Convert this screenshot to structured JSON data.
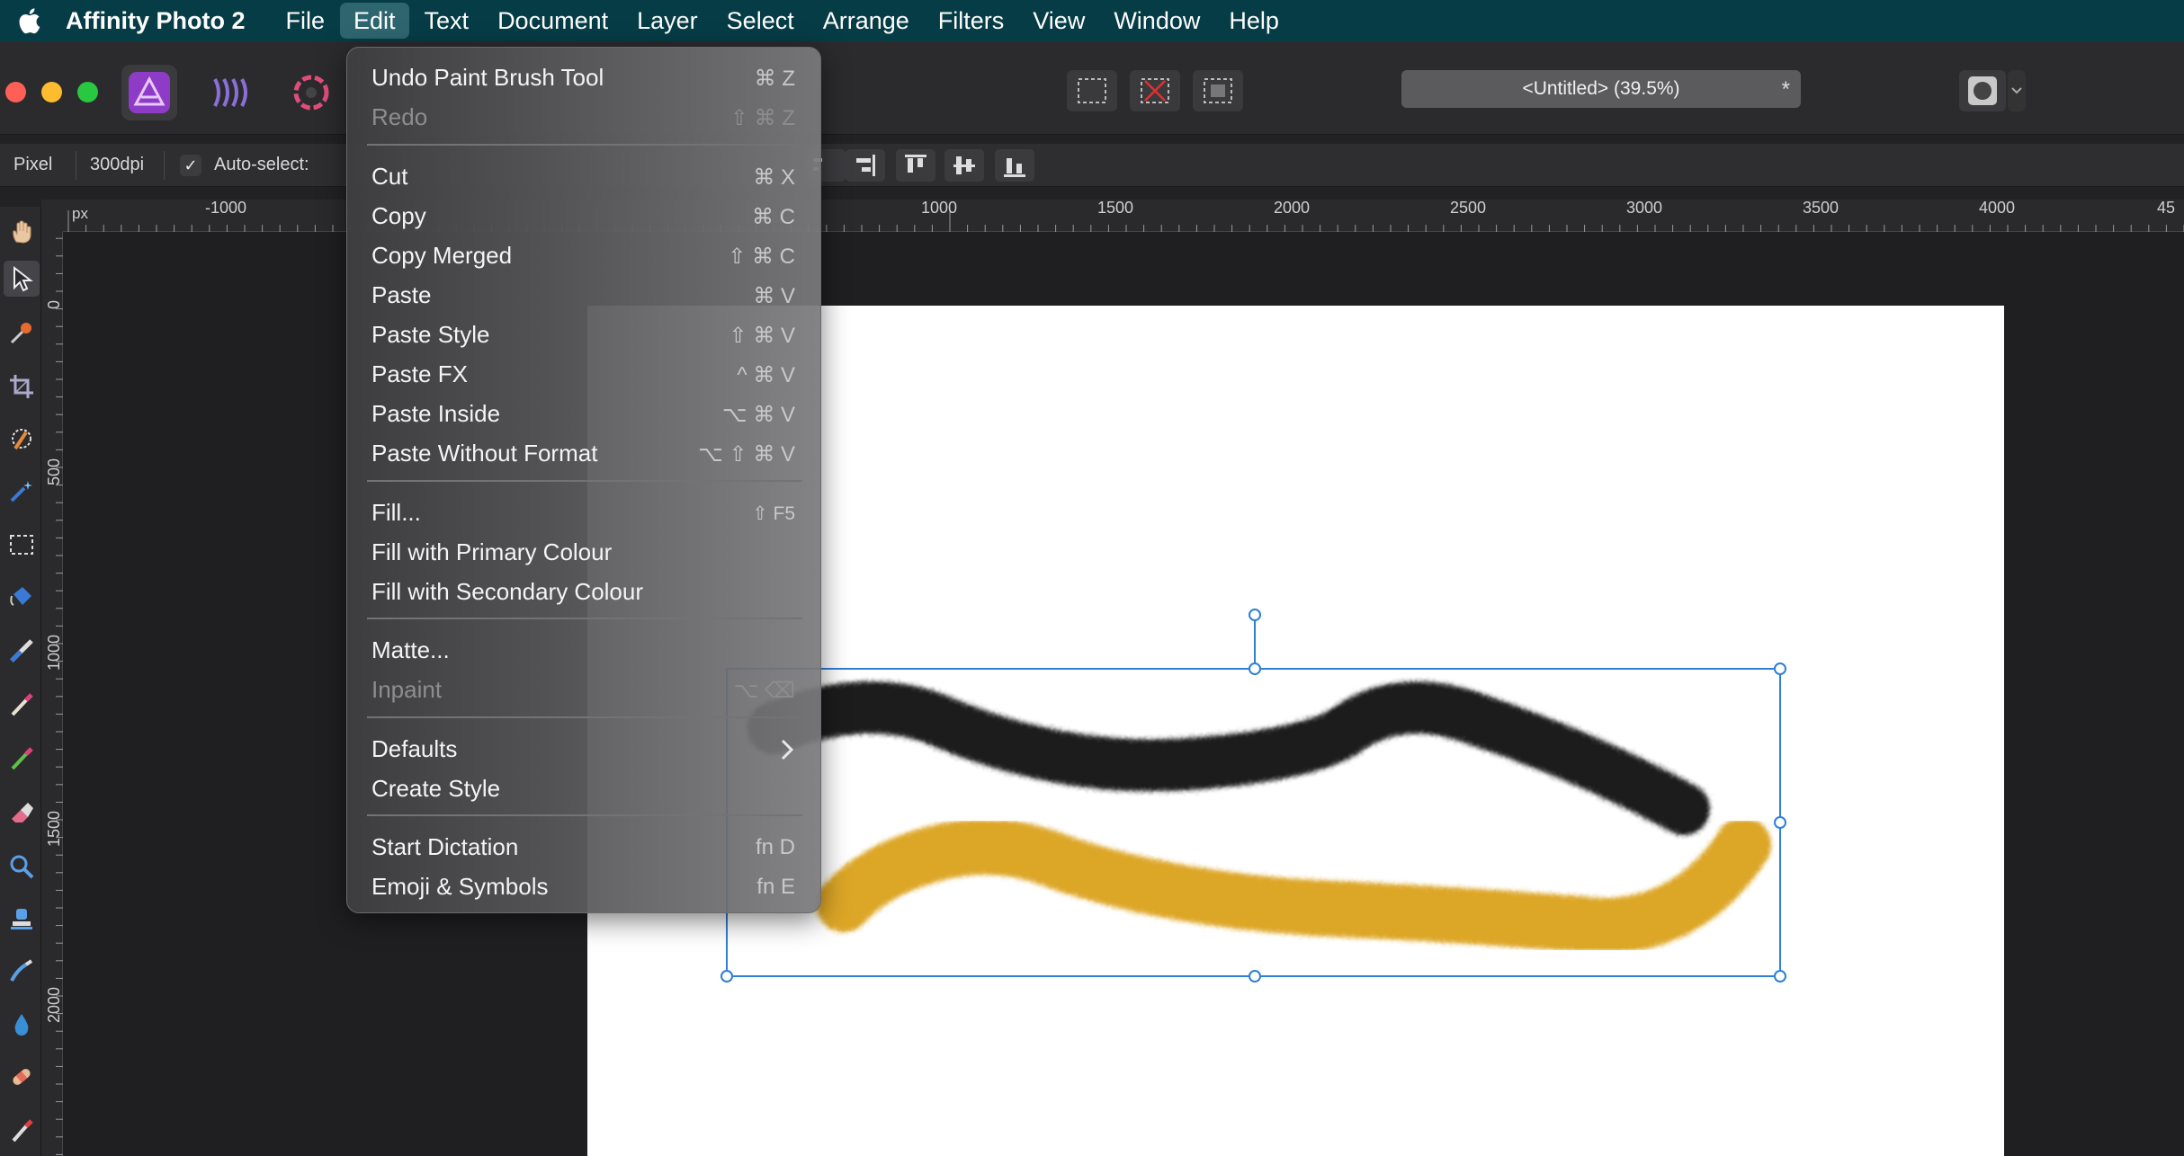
{
  "menubar": {
    "app_name": "Affinity Photo 2",
    "items": [
      "File",
      "Edit",
      "Text",
      "Document",
      "Layer",
      "Select",
      "Arrange",
      "Filters",
      "View",
      "Window",
      "Help"
    ],
    "active_item": "Edit"
  },
  "toolbar": {
    "document_title": "<Untitled> (39.5%)",
    "unsaved_mark": "*"
  },
  "context_toolbar": {
    "units": "Pixel",
    "dpi": "300dpi",
    "auto_select_label": "Auto-select:",
    "auto_select_checked": "✓"
  },
  "ruler": {
    "unit": "px",
    "h_ticks": [
      "-1000",
      "1000",
      "1500",
      "2000",
      "2500",
      "3000",
      "3500",
      "4000",
      "45"
    ],
    "v_ticks": [
      "0",
      "500",
      "1000",
      "1500",
      "2000"
    ]
  },
  "edit_menu": {
    "items": [
      {
        "label": "Undo Paint Brush Tool",
        "shortcut": "⌘ Z",
        "enabled": true
      },
      {
        "label": "Redo",
        "shortcut": "⇧ ⌘ Z",
        "enabled": false
      },
      {
        "label": "Cut",
        "shortcut": "⌘ X",
        "enabled": true
      },
      {
        "label": "Copy",
        "shortcut": "⌘ C",
        "enabled": true
      },
      {
        "label": "Copy Merged",
        "shortcut": "⇧ ⌘ C",
        "enabled": true
      },
      {
        "label": "Paste",
        "shortcut": "⌘ V",
        "enabled": true
      },
      {
        "label": "Paste Style",
        "shortcut": "⇧ ⌘ V",
        "enabled": true
      },
      {
        "label": "Paste FX",
        "shortcut": "^ ⌘ V",
        "enabled": true
      },
      {
        "label": "Paste Inside",
        "shortcut": "⌥ ⌘ V",
        "enabled": true
      },
      {
        "label": "Paste Without Format",
        "shortcut": "⌥ ⇧ ⌘ V",
        "enabled": true
      },
      {
        "label": "Fill...",
        "shortcut": "⇧ F5",
        "enabled": true
      },
      {
        "label": "Fill with Primary Colour",
        "shortcut": "",
        "enabled": true
      },
      {
        "label": "Fill with Secondary Colour",
        "shortcut": "",
        "enabled": true
      },
      {
        "label": "Matte...",
        "shortcut": "",
        "enabled": true
      },
      {
        "label": "Inpaint",
        "shortcut": "⌥ ⌫",
        "enabled": false
      },
      {
        "label": "Defaults",
        "shortcut": "",
        "enabled": true,
        "submenu": true
      },
      {
        "label": "Create Style",
        "shortcut": "",
        "enabled": true
      },
      {
        "label": "Start Dictation",
        "shortcut": "fn D",
        "enabled": true
      },
      {
        "label": "Emoji & Symbols",
        "shortcut": "fn E",
        "enabled": true
      }
    ]
  },
  "colors": {
    "menubar": "#063c46",
    "stroke_black": "#1e1e1e",
    "stroke_gold": "#dba21d",
    "selection": "#2f7fd6"
  }
}
